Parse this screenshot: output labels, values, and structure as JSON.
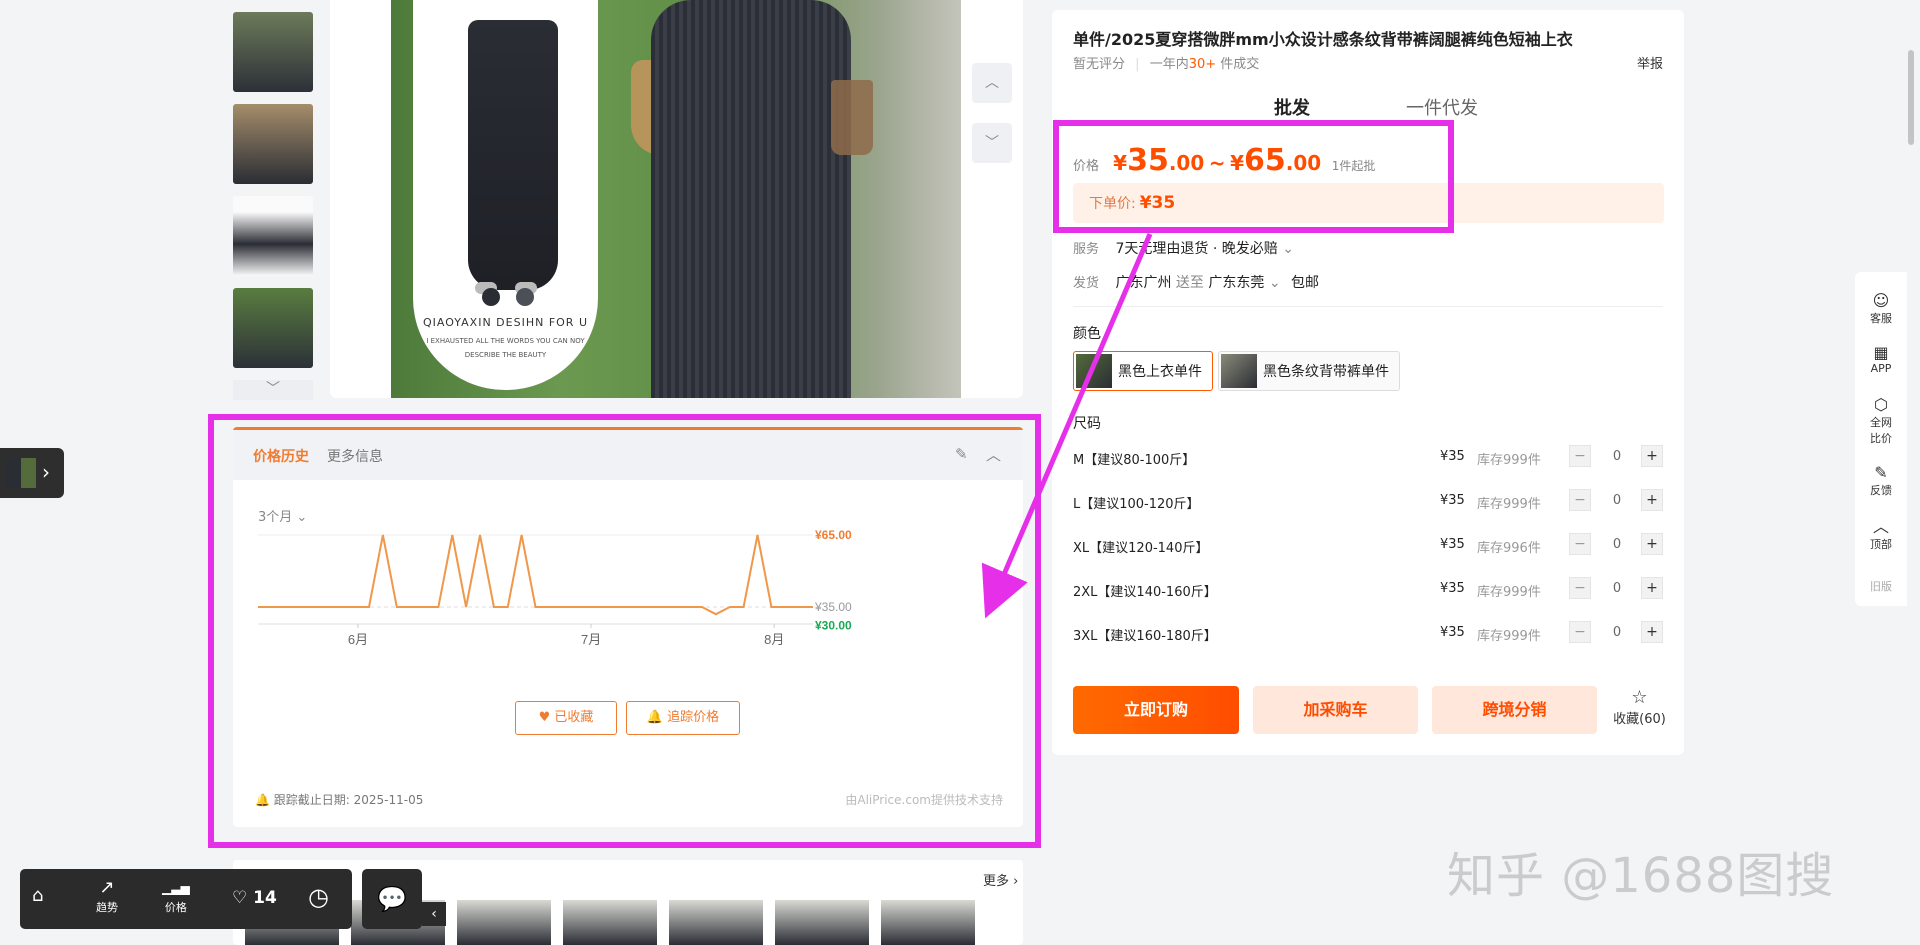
{
  "product": {
    "title": "单件/2025夏穿搭微胖mm小众设计感条纹背带裤阔腿裤纯色短袖上衣",
    "rating": "暂无评分",
    "sales_prefix": "一年内",
    "sales_count": "30+",
    "sales_suffix": "件成交",
    "report": "举报"
  },
  "tabs": {
    "wholesale": "批发",
    "dropship": "一件代发"
  },
  "price": {
    "label": "价格",
    "currency": "¥",
    "low_int": "35",
    "low_dec": ".00",
    "tilde": "~",
    "high_int": "65",
    "high_dec": ".00",
    "moq": "1件起批",
    "order_label": "下单价:",
    "order_value": "¥35"
  },
  "service": {
    "label": "服务",
    "value": "7天无理由退货 · 晚发必赔",
    "chev": "⌄"
  },
  "shipping": {
    "label": "发货",
    "from": "广东广州",
    "to_word": "送至",
    "to": "广东东莞",
    "chev": "⌄",
    "free": "包邮"
  },
  "color": {
    "label": "颜色",
    "options": [
      "黑色上衣单件",
      "黑色条纹背带裤单件"
    ]
  },
  "size": {
    "label": "尺码",
    "rows": [
      {
        "name": "M【建议80-100斤】",
        "price": "¥35",
        "stock": "库存999件",
        "qty": "0"
      },
      {
        "name": "L【建议100-120斤】",
        "price": "¥35",
        "stock": "库存999件",
        "qty": "0"
      },
      {
        "name": "XL【建议120-140斤】",
        "price": "¥35",
        "stock": "库存996件",
        "qty": "0"
      },
      {
        "name": "2XL【建议140-160斤】",
        "price": "¥35",
        "stock": "库存999件",
        "qty": "0"
      },
      {
        "name": "3XL【建议160-180斤】",
        "price": "¥35",
        "stock": "库存999件",
        "qty": "0"
      }
    ],
    "minus": "−",
    "plus": "+"
  },
  "actions": {
    "order": "立即订购",
    "cart": "加采购车",
    "cross": "跨境分销",
    "fav": "收藏(60)",
    "star": "☆"
  },
  "image": {
    "brand": "QIAOYAXIN DESIHN FOR U",
    "tagline1": "I EXHAUSTED ALL THE WORDS YOU CAN NOY",
    "tagline2": "DESCRIBE THE BEAUTY",
    "up": "︿",
    "down": "﹀",
    "thumb_more": "﹀"
  },
  "price_history": {
    "tab_active": "价格历史",
    "tab_more": "更多信息",
    "edit": "✎",
    "collapse": "︿",
    "range": "3个月 ⌄",
    "btn_saved": "♥ 已收藏",
    "btn_track": "🔔 追踪价格",
    "footer": "🔔 跟踪截止日期:  2025-11-05",
    "credit": "由AliPrice.com提供技术支持",
    "colors": {
      "line": "#f0974a",
      "high": "#f07c31",
      "low": "#1aaa55",
      "mid": "#999999"
    },
    "chart_data": {
      "type": "line",
      "x_ticks": [
        "6月",
        "7月",
        "8月"
      ],
      "y_labels": [
        "¥65.00",
        "¥35.00",
        "¥30.00"
      ],
      "ylim": [
        30,
        65
      ],
      "series": [
        {
          "values": [
            35,
            35,
            35,
            35,
            35,
            35,
            35,
            35,
            35,
            65,
            35,
            35,
            35,
            35,
            65,
            35,
            65,
            35,
            35,
            65,
            35,
            35,
            35,
            35,
            35,
            35,
            35,
            35,
            35,
            35,
            35,
            35,
            35,
            32,
            35,
            35,
            65,
            35,
            35,
            35,
            35
          ]
        }
      ]
    }
  },
  "sidebar": {
    "items": [
      {
        "icon": "☺",
        "label": "客服"
      },
      {
        "icon": "▦",
        "label": "APP"
      },
      {
        "icon": "⬡",
        "label": "全网\n比价"
      },
      {
        "icon": "✎",
        "label": "反馈"
      },
      {
        "icon": "︿",
        "label": "顶部"
      }
    ],
    "old": "旧版"
  },
  "related": {
    "more": "更多 ›"
  },
  "toolbar": {
    "home_icon": "⌂",
    "trend_icon": "↗",
    "trend": "趋势",
    "price_icon": "▁▃▅",
    "price": "价格",
    "likes": "♡ 14",
    "history_icon": "◷",
    "chat_icon": "💬",
    "collapse": "‹"
  },
  "watermark": "知乎 @1688图搜",
  "float_arrow": "›"
}
